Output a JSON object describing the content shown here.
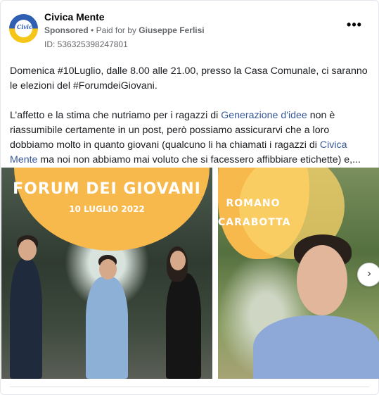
{
  "post": {
    "page_name": "Civica Mente",
    "avatar_text": "Civica",
    "sponsored_label": "Sponsored",
    "paid_for_prefix": "Paid for by",
    "paid_for_name": "Giuseppe Ferlisi",
    "ad_id": "ID: 536325398247801",
    "more_label": "•••",
    "paragraph1": "Domenica #10Luglio, dalle 8.00 alle 21.00, presso la Casa Comunale, ci saranno le elezioni del #ForumdeiGiovani.",
    "p2_part1": "L’affetto e la stima che nutriamo per i ragazzi di ",
    "p2_link1": "Generazione d'idee",
    "p2_part2": " non è riassumibile certamente in un post, però possiamo assicurarvi che a loro dobbiamo molto in quanto giovani (qualcuno li ha chiamati i ragazzi di ",
    "p2_link2": "Civica Mente",
    "p2_part3": " ma noi non abbiamo mai voluto che si facessero affibbiare etichette) e,..."
  },
  "carousel": {
    "card1": {
      "title": "FORUM DEI GIOVANI",
      "date": "10 LUGLIO 2022"
    },
    "card2": {
      "name_line1": "ROMANO",
      "name_line2": "CARABOTTA"
    },
    "next_label": "›"
  },
  "colors": {
    "accent_yellow": "#f7b84c",
    "link": "#385898",
    "muted": "#65676b"
  }
}
